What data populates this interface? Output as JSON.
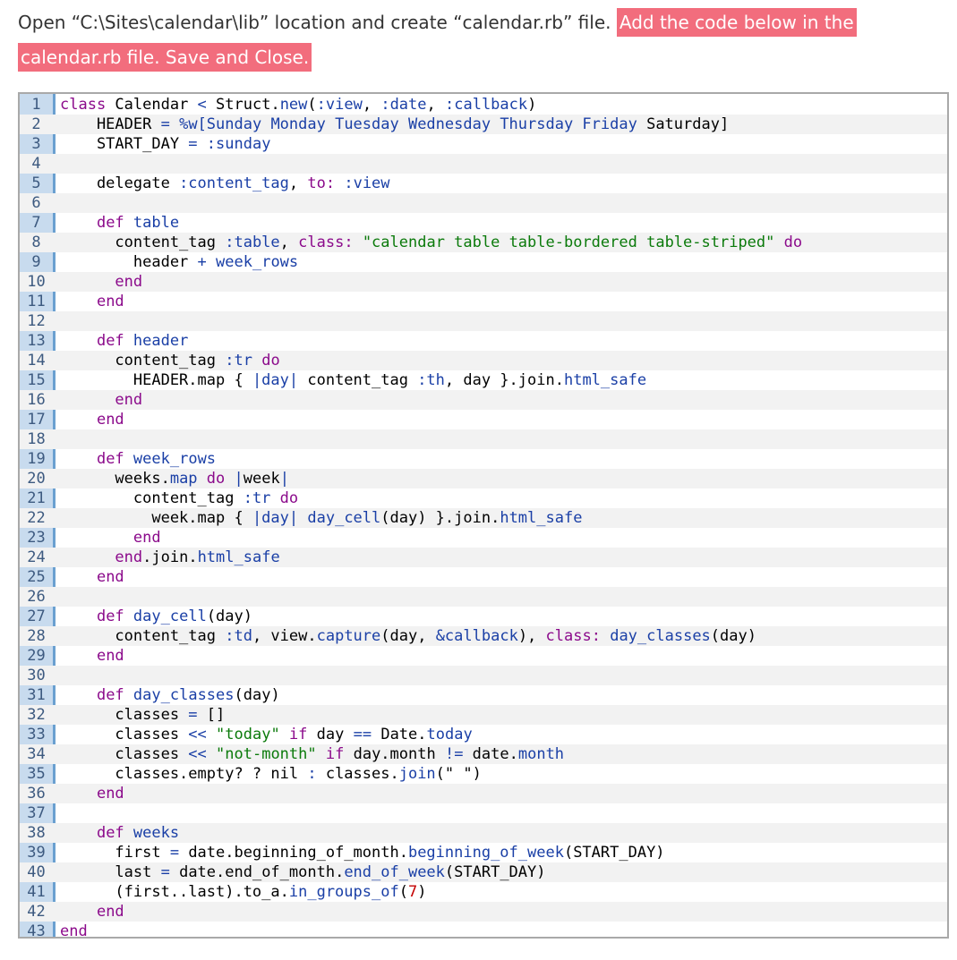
{
  "intro": {
    "text_plain": "Open “C:\\Sites\\calendar\\lib” location and create “calendar.rb” file. ",
    "text_highlight": "Add the code below in the calendar.rb file. Save and Close."
  },
  "colors": {
    "highlight_bg": "#f26d7d",
    "keyword": "#8b0a8b",
    "symbol": "#1a3fa6",
    "string": "#0b7a0b",
    "number": "#c40000",
    "gutter_bg": "#c8dbee",
    "gutter_border": "#6aa0d0"
  },
  "code": {
    "lines": [
      [
        [
          "kw",
          "class"
        ],
        [
          "t",
          " Calendar "
        ],
        [
          "sym",
          "<"
        ],
        [
          "t",
          " Struct."
        ],
        [
          "sym",
          "new"
        ],
        [
          "t",
          "("
        ],
        [
          "sym",
          ":view"
        ],
        [
          "t",
          ", "
        ],
        [
          "sym",
          ":date"
        ],
        [
          "t",
          ", "
        ],
        [
          "sym",
          ":callback"
        ],
        [
          "t",
          ")"
        ]
      ],
      [
        [
          "t",
          "    HEADER "
        ],
        [
          "sym",
          "="
        ],
        [
          "t",
          " "
        ],
        [
          "sym",
          "%w[Sunday Monday Tuesday Wednesday Thursday Friday"
        ],
        [
          "t",
          " Saturday]"
        ]
      ],
      [
        [
          "t",
          "    START_DAY "
        ],
        [
          "sym",
          "="
        ],
        [
          "t",
          " "
        ],
        [
          "sym",
          ":sunday"
        ]
      ],
      [],
      [
        [
          "t",
          "    delegate "
        ],
        [
          "sym",
          ":content_tag"
        ],
        [
          "t",
          ", "
        ],
        [
          "kw",
          "to:"
        ],
        [
          "t",
          " "
        ],
        [
          "sym",
          ":view"
        ]
      ],
      [],
      [
        [
          "t",
          "    "
        ],
        [
          "kw",
          "def"
        ],
        [
          "t",
          " "
        ],
        [
          "sym",
          "table"
        ]
      ],
      [
        [
          "t",
          "      content_tag "
        ],
        [
          "sym",
          ":table"
        ],
        [
          "t",
          ", "
        ],
        [
          "kw",
          "class:"
        ],
        [
          "t",
          " "
        ],
        [
          "str",
          "\"calendar table table-bordered table-striped\""
        ],
        [
          "t",
          " "
        ],
        [
          "kw",
          "do"
        ]
      ],
      [
        [
          "t",
          "        header "
        ],
        [
          "sym",
          "+"
        ],
        [
          "t",
          " "
        ],
        [
          "sym",
          "week_rows"
        ]
      ],
      [
        [
          "t",
          "      "
        ],
        [
          "kw",
          "end"
        ]
      ],
      [
        [
          "t",
          "    "
        ],
        [
          "kw",
          "end"
        ]
      ],
      [],
      [
        [
          "t",
          "    "
        ],
        [
          "kw",
          "def"
        ],
        [
          "t",
          " "
        ],
        [
          "sym",
          "header"
        ]
      ],
      [
        [
          "t",
          "      content_tag "
        ],
        [
          "sym",
          ":tr"
        ],
        [
          "t",
          " "
        ],
        [
          "kw",
          "do"
        ]
      ],
      [
        [
          "t",
          "        HEADER.map { "
        ],
        [
          "sym",
          "|day|"
        ],
        [
          "t",
          " content_tag "
        ],
        [
          "sym",
          ":th"
        ],
        [
          "t",
          ", day }.join."
        ],
        [
          "sym",
          "html_safe"
        ]
      ],
      [
        [
          "t",
          "      "
        ],
        [
          "kw",
          "end"
        ]
      ],
      [
        [
          "t",
          "    "
        ],
        [
          "kw",
          "end"
        ]
      ],
      [],
      [
        [
          "t",
          "    "
        ],
        [
          "kw",
          "def"
        ],
        [
          "t",
          " "
        ],
        [
          "sym",
          "week_rows"
        ]
      ],
      [
        [
          "t",
          "      weeks."
        ],
        [
          "sym",
          "map"
        ],
        [
          "t",
          " "
        ],
        [
          "kw",
          "do"
        ],
        [
          "t",
          " "
        ],
        [
          "sym",
          "|"
        ],
        [
          "t",
          "week"
        ],
        [
          "sym",
          "|"
        ]
      ],
      [
        [
          "t",
          "        content_tag "
        ],
        [
          "sym",
          ":tr"
        ],
        [
          "t",
          " "
        ],
        [
          "kw",
          "do"
        ]
      ],
      [
        [
          "t",
          "          week.map { "
        ],
        [
          "sym",
          "|day|"
        ],
        [
          "t",
          " "
        ],
        [
          "sym",
          "day_cell"
        ],
        [
          "t",
          "(day) }.join."
        ],
        [
          "sym",
          "html_safe"
        ]
      ],
      [
        [
          "t",
          "        "
        ],
        [
          "kw",
          "end"
        ]
      ],
      [
        [
          "t",
          "      "
        ],
        [
          "kw",
          "end"
        ],
        [
          "t",
          ".join."
        ],
        [
          "sym",
          "html_safe"
        ]
      ],
      [
        [
          "t",
          "    "
        ],
        [
          "kw",
          "end"
        ]
      ],
      [],
      [
        [
          "t",
          "    "
        ],
        [
          "kw",
          "def"
        ],
        [
          "t",
          " "
        ],
        [
          "sym",
          "day_cell"
        ],
        [
          "t",
          "(day)"
        ]
      ],
      [
        [
          "t",
          "      content_tag "
        ],
        [
          "sym",
          ":td"
        ],
        [
          "t",
          ", view."
        ],
        [
          "sym",
          "capture"
        ],
        [
          "t",
          "(day, "
        ],
        [
          "sym",
          "&callback"
        ],
        [
          "t",
          "), "
        ],
        [
          "kw",
          "class:"
        ],
        [
          "t",
          " "
        ],
        [
          "sym",
          "day_classes"
        ],
        [
          "t",
          "(day)"
        ]
      ],
      [
        [
          "t",
          "    "
        ],
        [
          "kw",
          "end"
        ]
      ],
      [],
      [
        [
          "t",
          "    "
        ],
        [
          "kw",
          "def"
        ],
        [
          "t",
          " "
        ],
        [
          "sym",
          "day_classes"
        ],
        [
          "t",
          "(day)"
        ]
      ],
      [
        [
          "t",
          "      classes "
        ],
        [
          "sym",
          "="
        ],
        [
          "t",
          " []"
        ]
      ],
      [
        [
          "t",
          "      classes "
        ],
        [
          "sym",
          "<<"
        ],
        [
          "t",
          " "
        ],
        [
          "str",
          "\"today\""
        ],
        [
          "t",
          " "
        ],
        [
          "kw",
          "if"
        ],
        [
          "t",
          " day "
        ],
        [
          "sym",
          "=="
        ],
        [
          "t",
          " Date."
        ],
        [
          "sym",
          "today"
        ]
      ],
      [
        [
          "t",
          "      classes "
        ],
        [
          "sym",
          "<<"
        ],
        [
          "t",
          " "
        ],
        [
          "str",
          "\"not-month\""
        ],
        [
          "t",
          " "
        ],
        [
          "kw",
          "if"
        ],
        [
          "t",
          " day.month "
        ],
        [
          "sym",
          "!="
        ],
        [
          "t",
          " date."
        ],
        [
          "sym",
          "month"
        ]
      ],
      [
        [
          "t",
          "      classes.empty? ? nil "
        ],
        [
          "sym",
          ":"
        ],
        [
          "t",
          " classes."
        ],
        [
          "sym",
          "join"
        ],
        [
          "t",
          "(\" \")"
        ]
      ],
      [
        [
          "t",
          "    "
        ],
        [
          "kw",
          "end"
        ]
      ],
      [],
      [
        [
          "t",
          "    "
        ],
        [
          "kw",
          "def"
        ],
        [
          "t",
          " "
        ],
        [
          "sym",
          "weeks"
        ]
      ],
      [
        [
          "t",
          "      first "
        ],
        [
          "sym",
          "="
        ],
        [
          "t",
          " date.beginning_of_month."
        ],
        [
          "sym",
          "beginning_of_week"
        ],
        [
          "t",
          "(START_DAY)"
        ]
      ],
      [
        [
          "t",
          "      last "
        ],
        [
          "sym",
          "="
        ],
        [
          "t",
          " date.end_of_month."
        ],
        [
          "sym",
          "end_of_week"
        ],
        [
          "t",
          "(START_DAY)"
        ]
      ],
      [
        [
          "t",
          "      (first..last).to_a."
        ],
        [
          "sym",
          "in_groups_of"
        ],
        [
          "t",
          "("
        ],
        [
          "num",
          "7"
        ],
        [
          "t",
          ")"
        ]
      ],
      [
        [
          "t",
          "    "
        ],
        [
          "kw",
          "end"
        ]
      ],
      [
        [
          "kw",
          "end"
        ]
      ]
    ]
  }
}
